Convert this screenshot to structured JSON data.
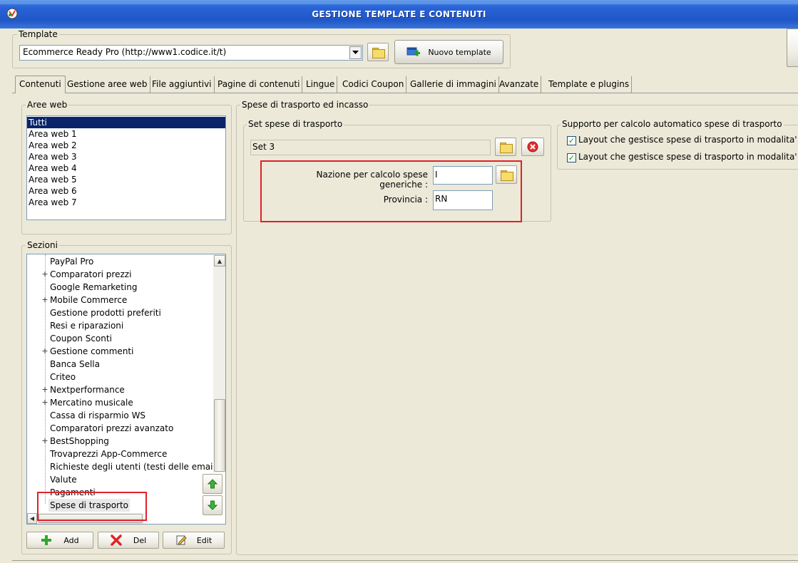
{
  "window": {
    "title": "GESTIONE TEMPLATE E CONTENUTI"
  },
  "template_group": {
    "legend": "Template",
    "selected": "Ecommerce Ready Pro (http://www1.codice.it/t)",
    "new_template_label": "Nuovo template"
  },
  "tabs": [
    {
      "label": "Contenuti",
      "active": true
    },
    {
      "label": "Gestione aree web"
    },
    {
      "label": "File aggiuntivi"
    },
    {
      "label": "Pagine di contenuti"
    },
    {
      "label": "Lingue"
    },
    {
      "label": "Codici Coupon"
    },
    {
      "label": "Gallerie di immagini"
    },
    {
      "label": "Avanzate"
    },
    {
      "label": "Template e plugins"
    }
  ],
  "aree_web": {
    "legend": "Aree web",
    "items": [
      "Tutti",
      "Area web 1",
      "Area web 2",
      "Area web 3",
      "Area web 4",
      "Area web 5",
      "Area web 6",
      "Area web 7"
    ],
    "selected_index": 0
  },
  "sezioni": {
    "legend": "Sezioni",
    "items": [
      {
        "label": "PayPal Pro",
        "expandable": false
      },
      {
        "label": "Comparatori prezzi",
        "expandable": true
      },
      {
        "label": "Google Remarketing",
        "expandable": false
      },
      {
        "label": "Mobile Commerce",
        "expandable": true
      },
      {
        "label": "Gestione prodotti preferiti",
        "expandable": false
      },
      {
        "label": "Resi e riparazioni",
        "expandable": false
      },
      {
        "label": "Coupon Sconti",
        "expandable": false
      },
      {
        "label": "Gestione commenti",
        "expandable": true
      },
      {
        "label": "Banca Sella",
        "expandable": false
      },
      {
        "label": "Criteo",
        "expandable": false
      },
      {
        "label": "Nextperformance",
        "expandable": true
      },
      {
        "label": "Mercatino musicale",
        "expandable": true
      },
      {
        "label": "Cassa di risparmio WS",
        "expandable": false
      },
      {
        "label": "Comparatori prezzi avanzato",
        "expandable": false
      },
      {
        "label": "BestShopping",
        "expandable": true
      },
      {
        "label": "Trovaprezzi App-Commerce",
        "expandable": false
      },
      {
        "label": "Richieste degli utenti (testi delle email)",
        "expandable": false
      },
      {
        "label": "Valute",
        "expandable": false
      },
      {
        "label": "Pagamenti",
        "expandable": false
      },
      {
        "label": "Spese di trasporto",
        "expandable": false,
        "selected": true
      }
    ],
    "buttons": {
      "add": "Add",
      "del": "Del",
      "edit": "Edit"
    }
  },
  "main_group": {
    "legend": "Spese di trasporto ed incasso"
  },
  "set_spese": {
    "legend": "Set spese di trasporto",
    "value": "Set 3",
    "nazione_label": "Nazione per calcolo spese generiche :",
    "nazione_value": "I",
    "provincia_label": "Provincia :",
    "provincia_value": "RN"
  },
  "supporto": {
    "legend": "Supporto per calcolo automatico spese di trasporto",
    "options": [
      {
        "label": "Layout che gestisce spese di trasporto in modalita' sem",
        "checked": true
      },
      {
        "label": "Layout che gestisce spese di trasporto in modalita' ava",
        "checked": true
      }
    ]
  },
  "colors": {
    "titlebar": "#2a64d6",
    "highlight": "#e0202a",
    "selection": "#0a246a"
  }
}
